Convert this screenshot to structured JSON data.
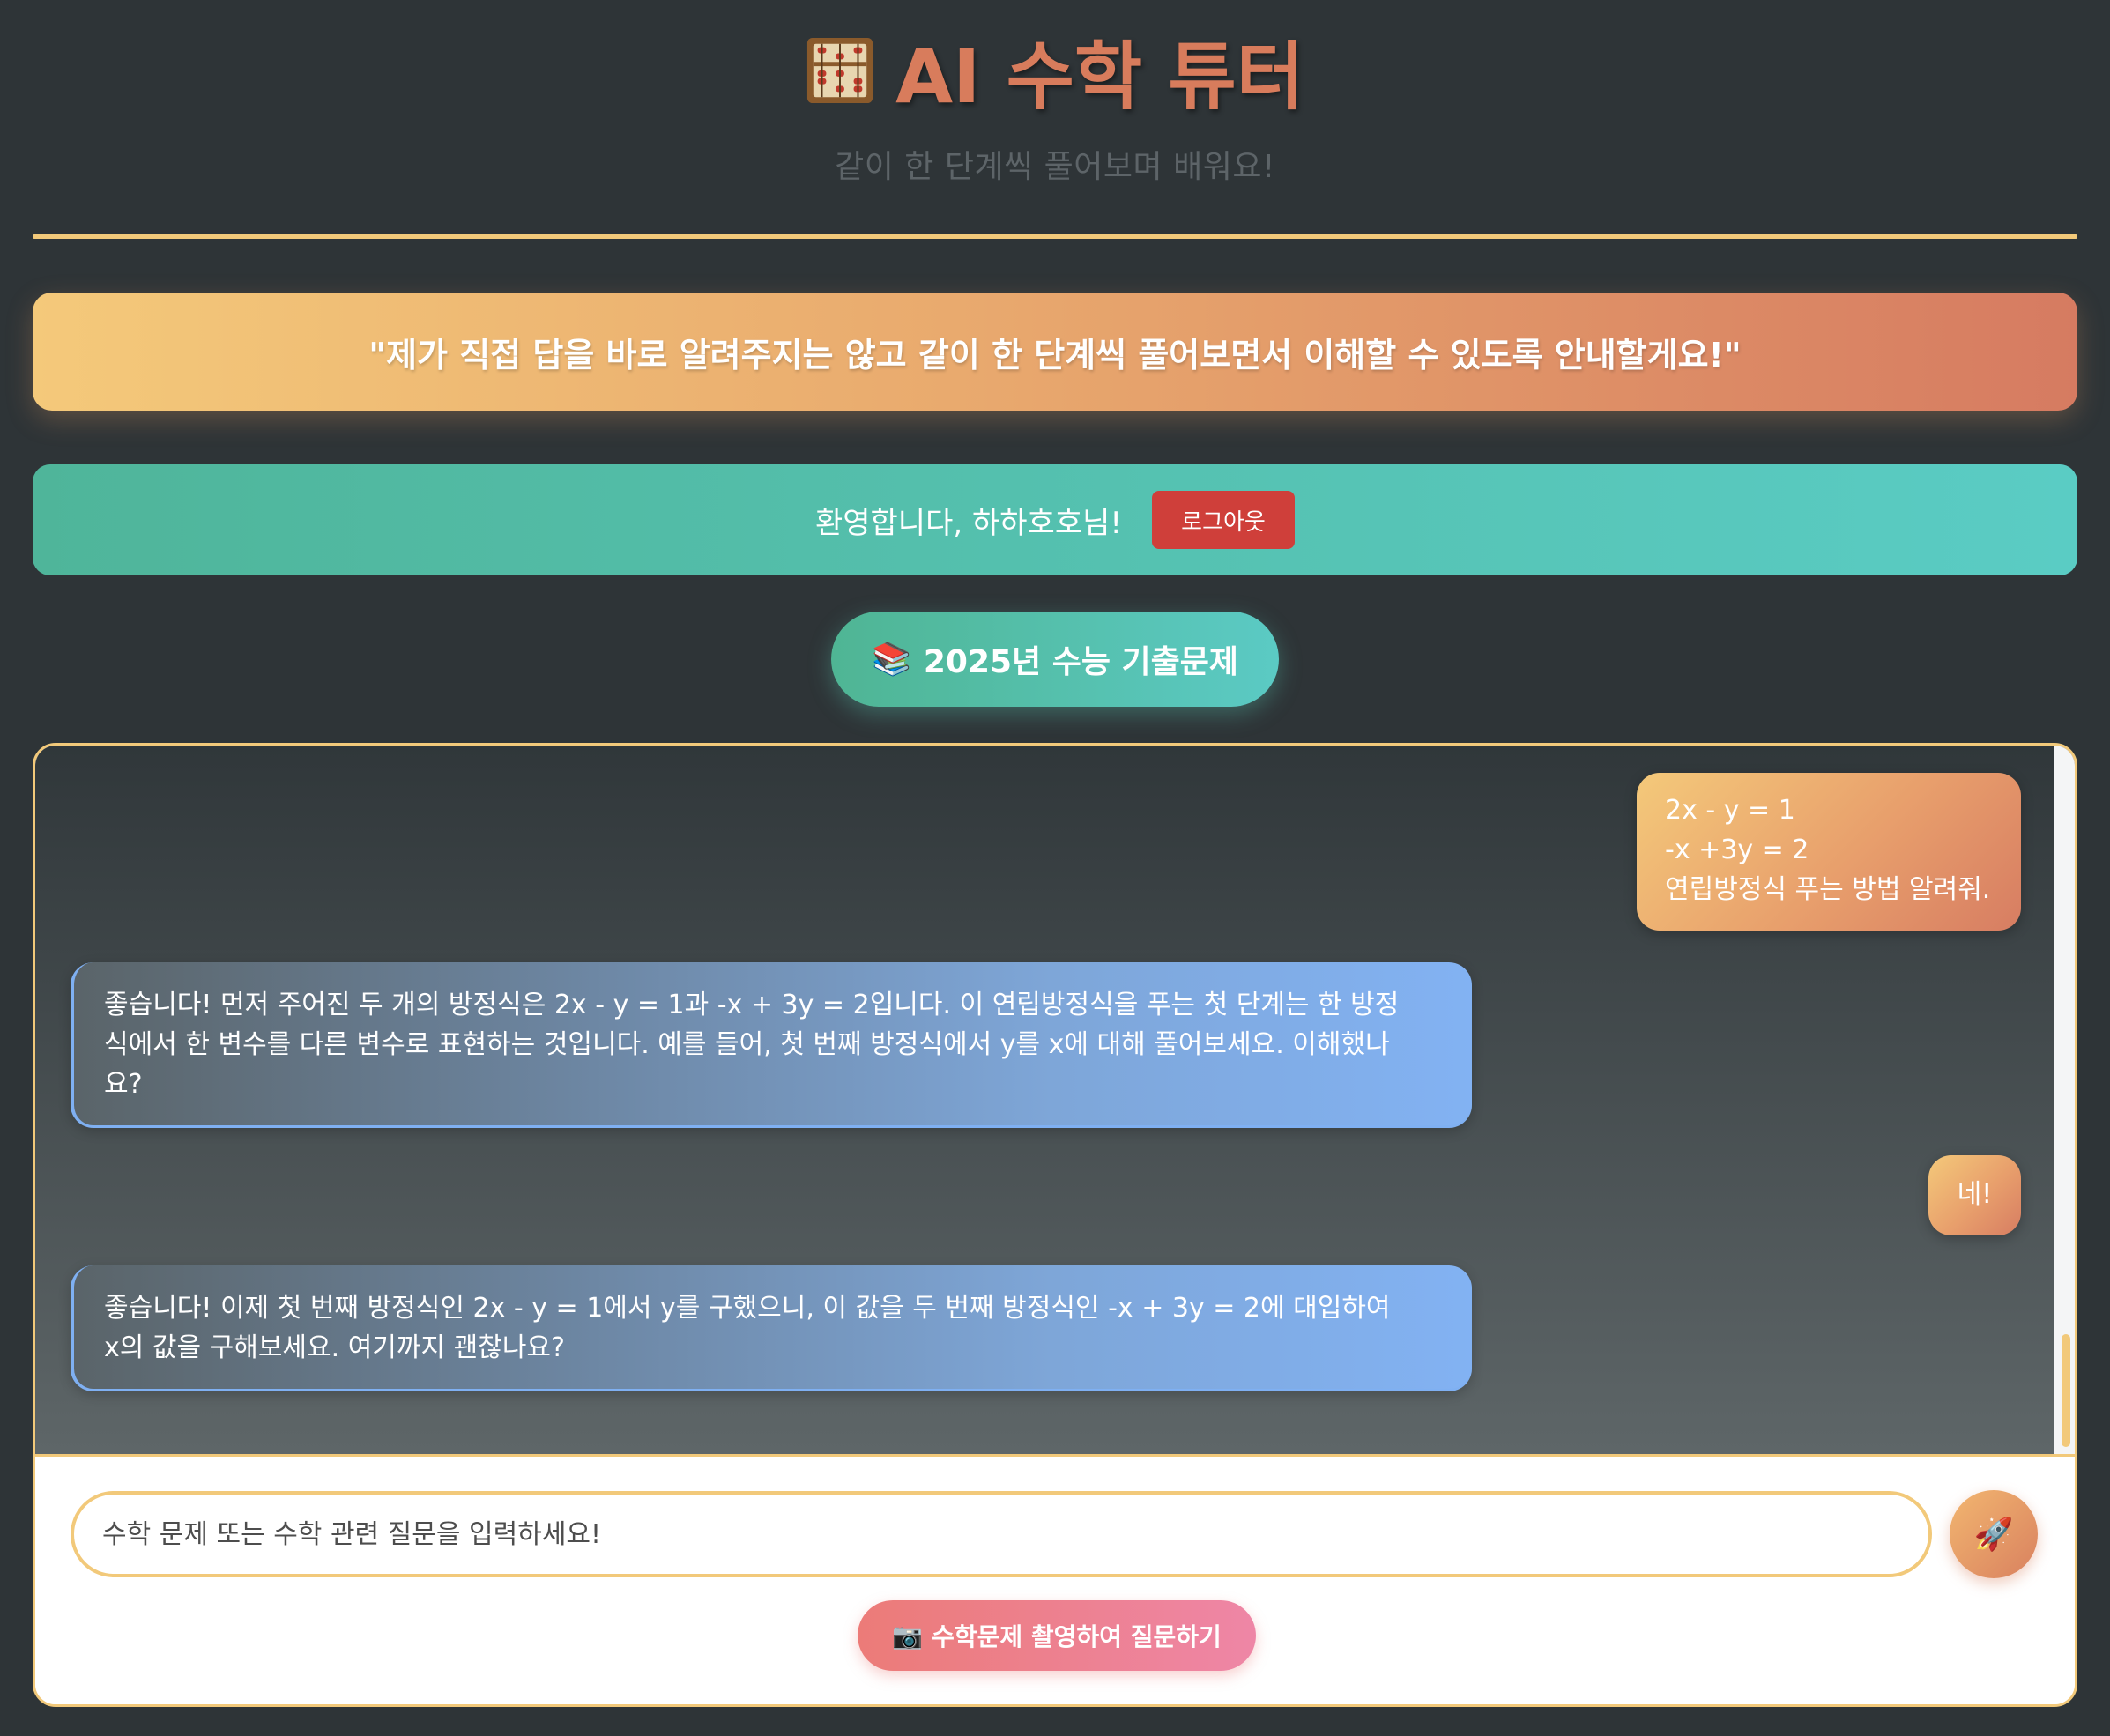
{
  "header": {
    "title": "AI 수학 튜터",
    "subtitle": "같이 한 단계씩 풀어보며 배워요!"
  },
  "quote": {
    "text": "\"제가 직접 답을 바로 알려주지는 않고 같이 한 단계씩 풀어보면서 이해할 수 있도록 안내할게요!\""
  },
  "welcome": {
    "text": "환영합니다, 하하호호님!",
    "logout_label": "로그아웃"
  },
  "exam_button": {
    "icon": "📚",
    "label": "2025년 수능 기출문제"
  },
  "messages": [
    {
      "role": "user",
      "lines": [
        "2x - y = 1",
        "-x +3y = 2",
        "연립방정식 푸는 방법 알려줘."
      ]
    },
    {
      "role": "ai",
      "lines": [
        "좋습니다! 먼저 주어진 두 개의 방정식은 2x - y = 1과 -x + 3y = 2입니다. 이 연립방정식을 푸는 첫 단계는 한 방정",
        "식에서 한 변수를 다른 변수로 표현하는 것입니다. 예를 들어, 첫 번째 방정식에서 y를 x에 대해 풀어보세요. 이해했나",
        "요?"
      ]
    },
    {
      "role": "user",
      "lines": [
        "네!"
      ]
    },
    {
      "role": "ai",
      "lines": [
        "좋습니다! 이제 첫 번째 방정식인 2x - y = 1에서 y를 구했으니, 이 값을 두 번째 방정식인 -x + 3y = 2에 대입하여",
        "x의 값을 구해보세요. 여기까지 괜찮나요?"
      ]
    }
  ],
  "input": {
    "placeholder": "수학 문제 또는 수학 관련 질문을 입력하세요!",
    "send_icon": "🚀"
  },
  "photo_button": {
    "icon": "📷",
    "label": "수학문제 촬영하여 질문하기"
  },
  "colors": {
    "background": "#2e3437",
    "title": "#d87c5c",
    "accent_gold": "#f2c97a",
    "teal": "#4fb59a",
    "logout": "#cf3f3a",
    "ai_bubble": "#82b2f3",
    "photo_button": "#ec7b78"
  }
}
